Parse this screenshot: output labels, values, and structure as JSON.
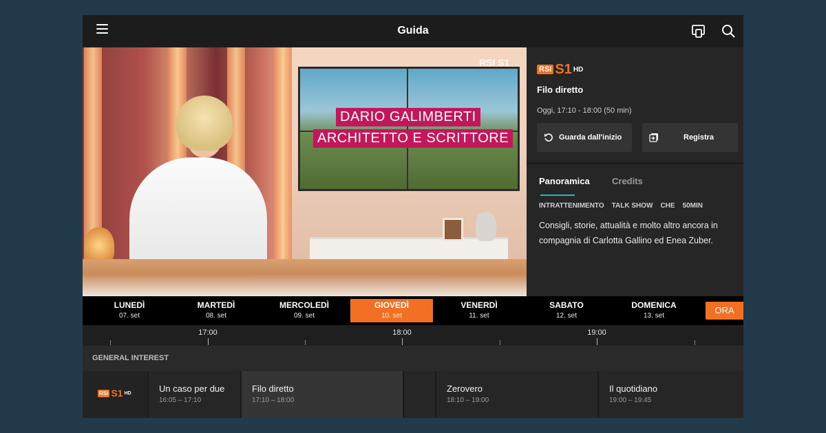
{
  "header": {
    "title": "Guida",
    "menu_icon": "hamburger-icon",
    "cast_icon": "cast-device-icon",
    "search_icon": "search-icon"
  },
  "video": {
    "watermark": "RSI S1",
    "caption_line1": "DARIO GALIMBERTI",
    "caption_line2": "ARCHITETTO E SCRITTORE"
  },
  "detail": {
    "channel": {
      "rsi": "RSI",
      "s1": "S1",
      "hd": "HD"
    },
    "title": "Filo diretto",
    "time": "Oggi, 17:10 - 18:00 (50 min)",
    "watch_button": "Guarda dall'inizio",
    "record_button": "Registra",
    "tabs": [
      "Panoramica",
      "Credits"
    ],
    "tags": [
      "INTRATTENIMENTO",
      "TALK SHOW",
      "CHE",
      "50MIN"
    ],
    "description": "Consigli, storie, attualità e molto altro ancora in compagnia di Carlotta Gallino ed Enea Zuber."
  },
  "days": [
    {
      "name": "LUNEDÌ",
      "date": "07. set"
    },
    {
      "name": "MARTEDÌ",
      "date": "08. set"
    },
    {
      "name": "MERCOLEDÌ",
      "date": "09. set"
    },
    {
      "name": "GIOVEDÌ",
      "date": "10. set"
    },
    {
      "name": "VENERDÌ",
      "date": "11. set"
    },
    {
      "name": "SABATO",
      "date": "12. set"
    },
    {
      "name": "DOMENICA",
      "date": "13. set"
    }
  ],
  "now_button": "ORA",
  "timeline": {
    "labels": [
      "17:00",
      "18:00",
      "19:00"
    ]
  },
  "section_title": "GENERAL INTEREST",
  "programs": [
    {
      "title": "Un caso per due",
      "time": "16:05 – 17:10"
    },
    {
      "title": "Filo diretto",
      "time": "17:10 – 18:00"
    },
    {
      "title": "Zerovero",
      "time": "18:10 – 19:00"
    },
    {
      "title": "Il quotidiano",
      "time": "19:00 – 19:45"
    }
  ],
  "colors": {
    "accent": "#f36f21",
    "tab_indicator": "#2bb3c0"
  }
}
